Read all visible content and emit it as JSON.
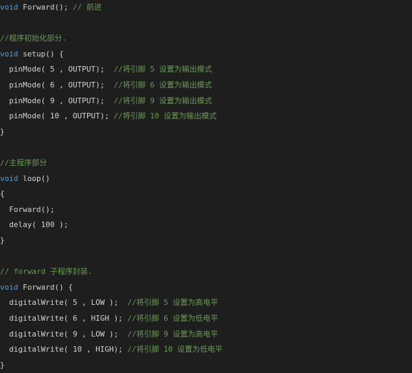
{
  "editor": {
    "language": "Arduino C++",
    "colors": {
      "background": "#1e1e1e",
      "keyword": "#569cd6",
      "text": "#d4d4d4",
      "comment": "#6a9955"
    },
    "lines": [
      {
        "parts": [
          {
            "t": "kw",
            "s": "void"
          },
          {
            "t": "tx",
            "s": " Forward(); "
          },
          {
            "t": "cm",
            "s": "// 前进"
          }
        ]
      },
      {
        "parts": []
      },
      {
        "parts": [
          {
            "t": "cm",
            "s": "//程序初始化部分."
          }
        ]
      },
      {
        "parts": [
          {
            "t": "kw",
            "s": "void"
          },
          {
            "t": "tx",
            "s": " setup() {"
          }
        ]
      },
      {
        "parts": [
          {
            "t": "tx",
            "s": "  pinMode( 5 , OUTPUT);  "
          },
          {
            "t": "cm",
            "s": "//将引脚 5 设置为输出模式"
          }
        ]
      },
      {
        "parts": [
          {
            "t": "tx",
            "s": "  pinMode( 6 , OUTPUT);  "
          },
          {
            "t": "cm",
            "s": "//将引脚 6 设置为输出模式"
          }
        ]
      },
      {
        "parts": [
          {
            "t": "tx",
            "s": "  pinMode( 9 , OUTPUT);  "
          },
          {
            "t": "cm",
            "s": "//将引脚 9 设置为输出模式"
          }
        ]
      },
      {
        "parts": [
          {
            "t": "tx",
            "s": "  pinMode( 10 , OUTPUT); "
          },
          {
            "t": "cm",
            "s": "//将引脚 10 设置为输出模式"
          }
        ]
      },
      {
        "parts": [
          {
            "t": "tx",
            "s": "}"
          }
        ]
      },
      {
        "parts": []
      },
      {
        "parts": [
          {
            "t": "cm",
            "s": "//主程序部分"
          }
        ]
      },
      {
        "parts": [
          {
            "t": "kw",
            "s": "void"
          },
          {
            "t": "tx",
            "s": " loop()"
          }
        ]
      },
      {
        "parts": [
          {
            "t": "tx",
            "s": "{"
          }
        ]
      },
      {
        "parts": [
          {
            "t": "tx",
            "s": "  Forward();"
          }
        ]
      },
      {
        "parts": [
          {
            "t": "tx",
            "s": "  delay( 100 );"
          }
        ]
      },
      {
        "parts": [
          {
            "t": "tx",
            "s": "}"
          }
        ]
      },
      {
        "parts": []
      },
      {
        "parts": [
          {
            "t": "cm",
            "s": "// forward 子程序封装."
          }
        ]
      },
      {
        "parts": [
          {
            "t": "kw",
            "s": "void"
          },
          {
            "t": "tx",
            "s": " Forward() {"
          }
        ]
      },
      {
        "parts": [
          {
            "t": "tx",
            "s": "  digitalWrite( 5 , LOW );  "
          },
          {
            "t": "cm",
            "s": "//将引脚 5 设置为高电平"
          }
        ]
      },
      {
        "parts": [
          {
            "t": "tx",
            "s": "  digitalWrite( 6 , HIGH ); "
          },
          {
            "t": "cm",
            "s": "//将引脚 6 设置为低电平"
          }
        ]
      },
      {
        "parts": [
          {
            "t": "tx",
            "s": "  digitalWrite( 9 , LOW );  "
          },
          {
            "t": "cm",
            "s": "//将引脚 9 设置为高电平"
          }
        ]
      },
      {
        "parts": [
          {
            "t": "tx",
            "s": "  digitalWrite( 10 , HIGH); "
          },
          {
            "t": "cm",
            "s": "//将引脚 10 设置为低电平"
          }
        ]
      },
      {
        "parts": [
          {
            "t": "tx",
            "s": "}"
          }
        ]
      }
    ]
  }
}
